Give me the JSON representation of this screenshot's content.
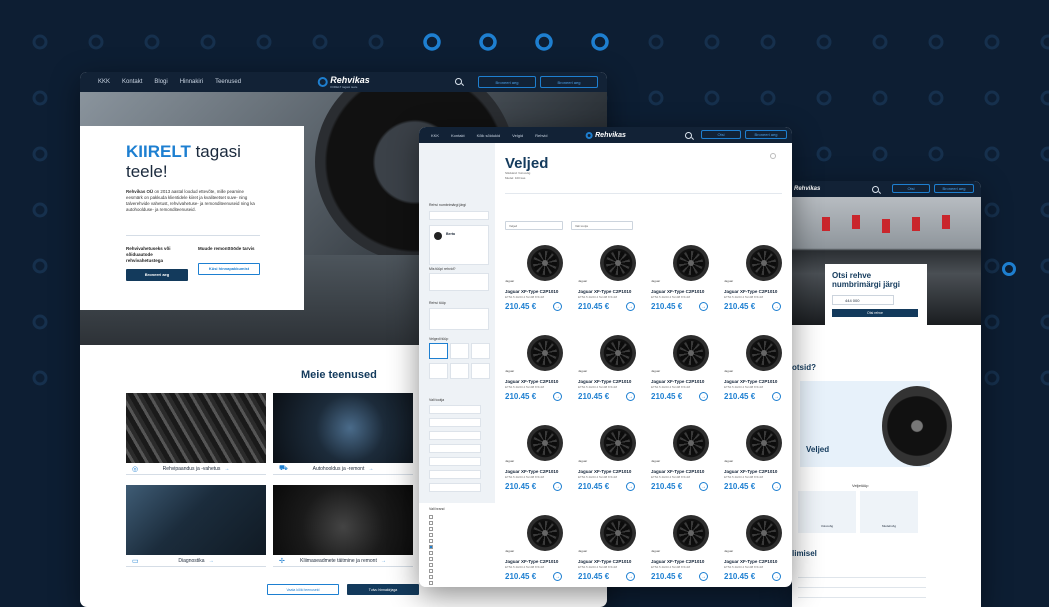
{
  "colors": {
    "bg": "#0d1e33",
    "accent": "#1d7fd1",
    "dark": "#133a5c"
  },
  "shot1": {
    "nav": [
      "KKK",
      "Kontakt",
      "Blogi",
      "Hinnakiri",
      "Teenused"
    ],
    "logo": "Rehvikas",
    "logo_sub": "KIIRELT tagasi teele",
    "nav_btn1": "Broneeri aeg",
    "nav_btn2": "Broneeri aeg",
    "hero_title_bold": "KIIRELT",
    "hero_title_rest": " tagasi teele!",
    "hero_text_bold": "Rehvikas OÜ",
    "hero_text": " on 2013 aastal loodud ettevõte, mille peamine eesmärk on pakkuda klientidele kiiret ja kvaliteetset suve- ning talverehvide vahetust, rehvivahetuse- ja remonditeenuseid ning ka autohoolduse- ja remonditeenuseid.",
    "col1_title": "Rehvivahetuseks või sõiduautode rehvivahetustega",
    "col2_title": "Muude remonttööde tarvis",
    "col1_btn": "Broneeri aeg",
    "col2_btn": "Küsi hinnapakkumist",
    "section": "Meie teenused",
    "services": [
      "Rehvipaandus ja -vahetus",
      "Autohooldus ja -remont",
      "Diagnostika",
      "Kliimaseadmete täitmine ja remont"
    ],
    "btn_all": "Vaata kõiki teenuseid",
    "btn_price": "Tutvu hinnakirjaga"
  },
  "shot2": {
    "nav": [
      "KKK",
      "Kontakt",
      "Kõik sõidukid",
      "Velgid",
      "Rehvid"
    ],
    "logo": "Rehvikas",
    "btn1": "Otsi",
    "btn2": "Broneeri aeg",
    "title": "Veljed",
    "meta1": "Sõidukid: Volvovõg",
    "meta2": "Mudel: 100 kas",
    "side": [
      "Rehvi numbrimärgi järgi",
      "Berta",
      "Mis tüüpi rehvid?",
      "Rehvi tüüp",
      "Velgedi tüüp",
      "Vali tootja",
      "Vali brand"
    ],
    "filter1": "Veljed",
    "filter2": "Vali tootja",
    "card": {
      "brand": "Jaguar",
      "name": "Jaguar XF-Type C2P1010",
      "desc": "ET52.5 4H63.4 5x108 8.5x18",
      "price": "210.45 €"
    }
  },
  "shot3": {
    "heading": "Otsi rehve numbrimärgi järgi",
    "plate": "444 000",
    "btn": "Otsi rehve",
    "q": "otsid?",
    "veljed": "Veljed",
    "veljetuup": "Veljetüüp",
    "volvo": "Volvovõg",
    "mudel": "Mudelrvõg",
    "limisel": "limisel"
  }
}
